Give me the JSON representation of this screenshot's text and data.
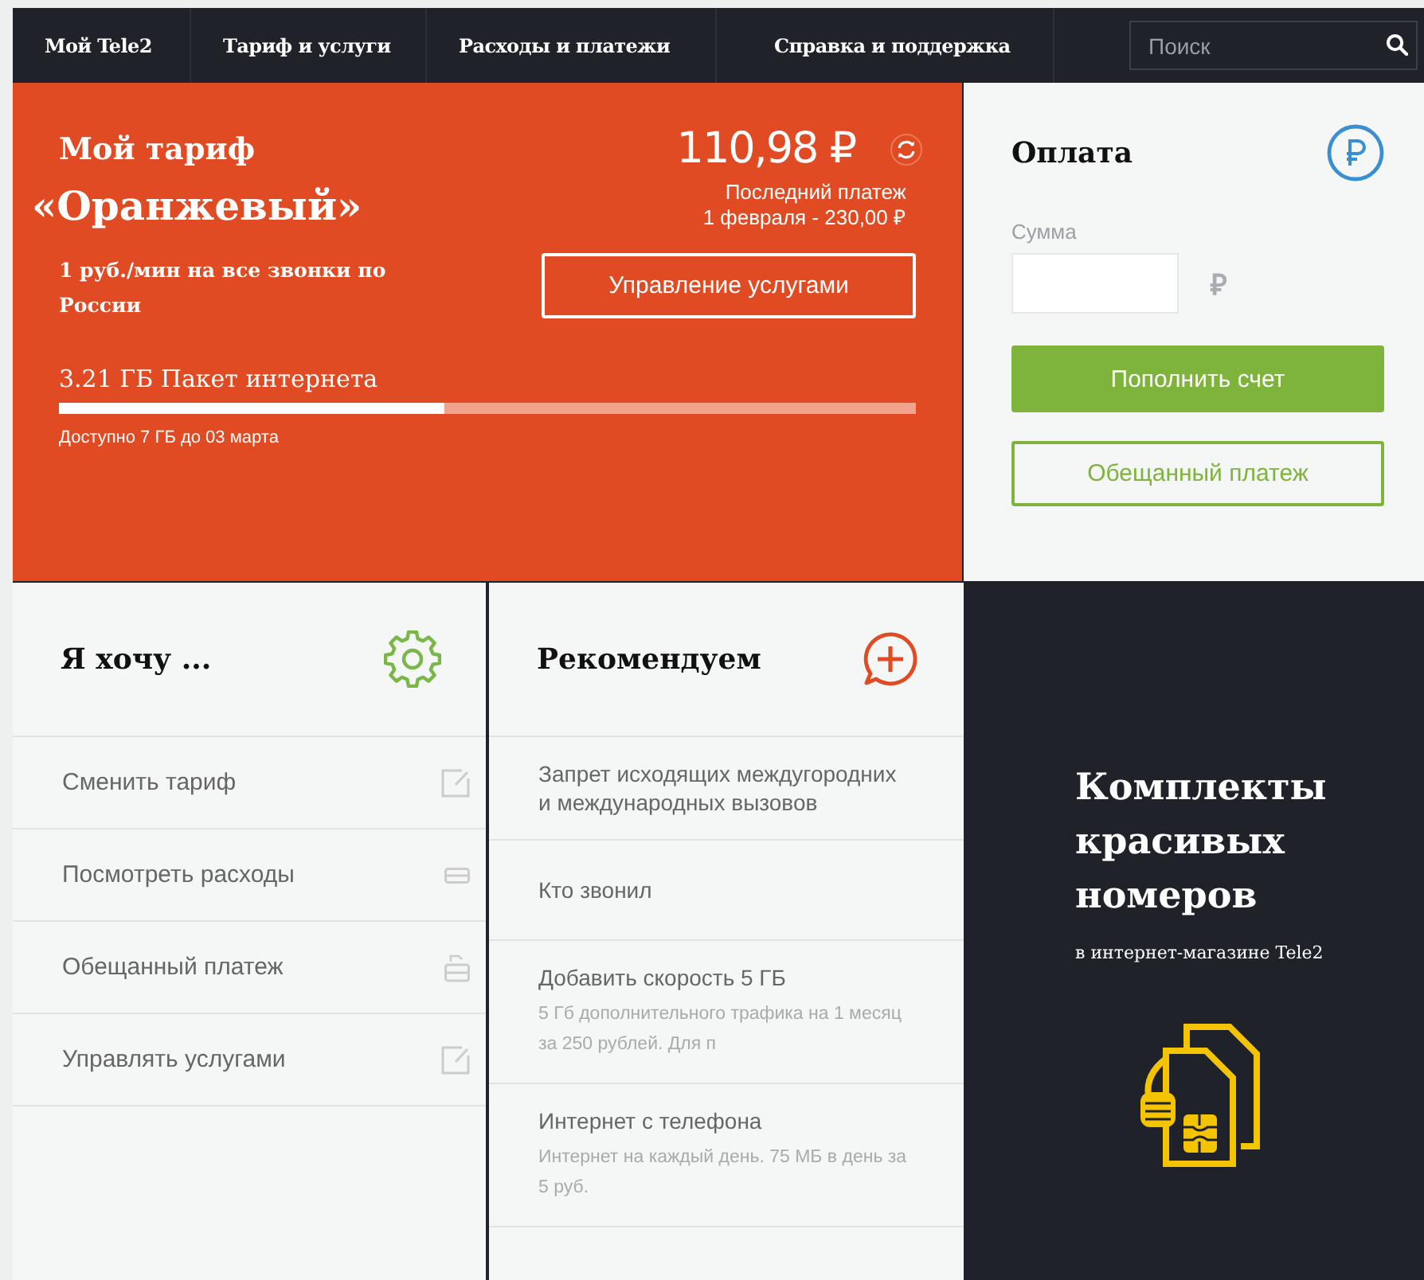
{
  "nav": {
    "items": [
      "Мой Tele2",
      "Тариф и услуги",
      "Расходы и платежи",
      "Справка и поддержка"
    ],
    "search": {
      "placeholder": "Поиск"
    }
  },
  "tariff": {
    "heading": "Мой тариф",
    "name": "«Оранжевый»",
    "description": "1 руб./мин на все звонки по России",
    "balance": "110,98 ₽",
    "last_payment_label": "Последний платеж",
    "last_payment": "1 февраля - 230,00  ₽",
    "manage_button": "Управление услугами",
    "package": {
      "title": "3.21 ГБ Пакет интернета",
      "level": 0.45,
      "note": "Доступно 7 ГБ до 03 марта"
    }
  },
  "payment": {
    "title": "Оплата",
    "amount_label": "Сумма",
    "currency": "₽",
    "topup_button": "Пополнить счет",
    "promised_button": "Обещанный платеж"
  },
  "wants": {
    "title": "Я хочу ...",
    "items": [
      {
        "label": "Сменить тариф",
        "kind": "edit"
      },
      {
        "label": "Посмотреть расходы",
        "kind": "card"
      },
      {
        "label": "Обещанный платеж",
        "kind": "wallet"
      },
      {
        "label": "Управлять услугами",
        "kind": "edit"
      }
    ]
  },
  "recommend": {
    "title": "Рекомендуем",
    "items": [
      {
        "title": "Запрет исходящих междугородних и международных вызовов"
      },
      {
        "title": "Кто звонил"
      },
      {
        "title": "Добавить скорость 5 ГБ",
        "description": "5 Гб дополнительного трафика на 1 месяц за 250 рублей. Для п"
      },
      {
        "title": "Интернет с телефона",
        "description": "Интернет на каждый день. 75 МБ в день за 5 руб."
      }
    ]
  },
  "promo": {
    "title": "Комплекты красивых номеров",
    "subtitle": "в интернет-магазине Tele2"
  }
}
